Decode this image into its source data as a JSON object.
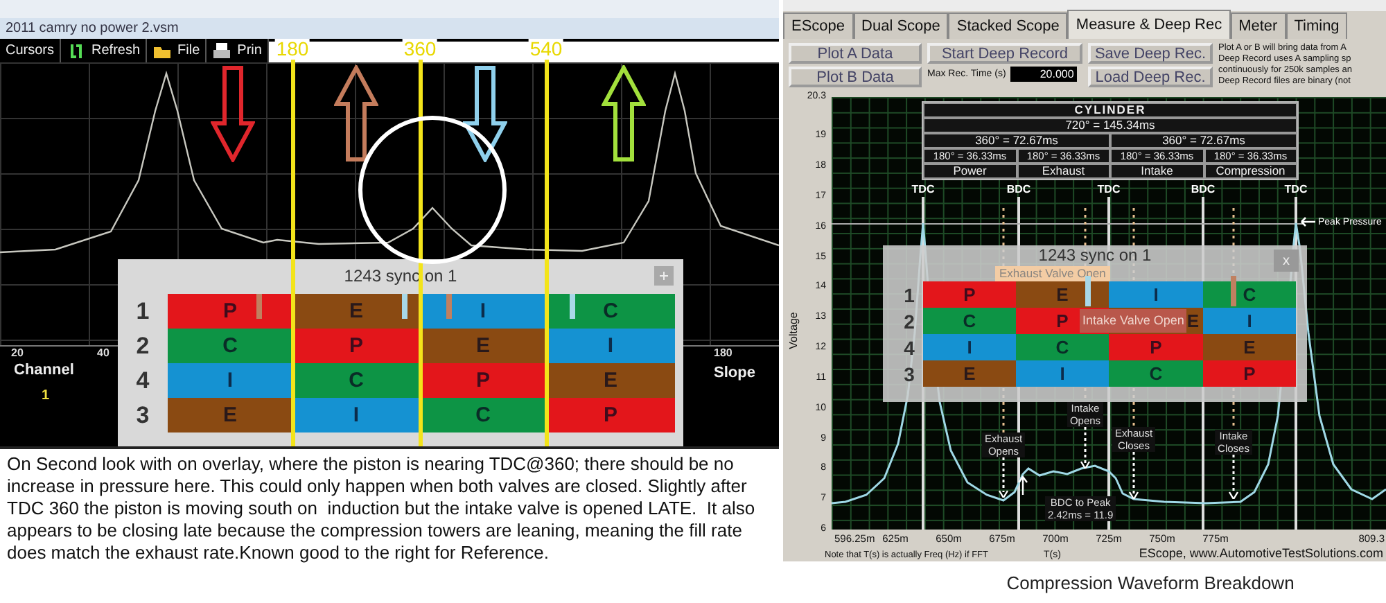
{
  "left_window": {
    "title": "2011 camry no power 2.vsm",
    "toolbar": [
      {
        "label": "Cursors"
      },
      {
        "label": "Refresh"
      },
      {
        "label": "File"
      },
      {
        "label": "Prin"
      }
    ],
    "cursor_labels": [
      "180",
      "360",
      "540"
    ],
    "arrows": [
      {
        "color": "#e0262c"
      },
      {
        "color": "#c47c5c"
      },
      {
        "color": "#8fd0ec"
      },
      {
        "color": "#a2e03c"
      }
    ],
    "scale_ticks": [
      "20",
      "40",
      "180"
    ],
    "channel_header": "Channel",
    "channel_value": "1",
    "slope_header": "Slope",
    "overlay": {
      "title": "1243 sync on 1",
      "rows": [
        {
          "cylinder": "1",
          "cells": [
            {
              "stroke": "P",
              "color": "#e3161b"
            },
            {
              "stroke": "E",
              "color": "#8a4a12"
            },
            {
              "stroke": "I",
              "color": "#1592d2"
            },
            {
              "stroke": "C",
              "color": "#0d9445"
            }
          ]
        },
        {
          "cylinder": "2",
          "cells": [
            {
              "stroke": "C",
              "color": "#0d9445"
            },
            {
              "stroke": "P",
              "color": "#e3161b"
            },
            {
              "stroke": "E",
              "color": "#8a4a12"
            },
            {
              "stroke": "I",
              "color": "#1592d2"
            }
          ]
        },
        {
          "cylinder": "4",
          "cells": [
            {
              "stroke": "I",
              "color": "#1592d2"
            },
            {
              "stroke": "C",
              "color": "#0d9445"
            },
            {
              "stroke": "P",
              "color": "#e3161b"
            },
            {
              "stroke": "E",
              "color": "#8a4a12"
            }
          ]
        },
        {
          "cylinder": "3",
          "cells": [
            {
              "stroke": "E",
              "color": "#8a4a12"
            },
            {
              "stroke": "I",
              "color": "#1592d2"
            },
            {
              "stroke": "C",
              "color": "#0d9445"
            },
            {
              "stroke": "P",
              "color": "#e3161b"
            }
          ]
        }
      ]
    }
  },
  "note": "On Second look with on overlay, where the piston is nearing TDC@360; there should be no increase in pressure here. This could only happen when both valves are closed. Slightly after TDC 360 the piston is moving south on  induction but the intake valve is opened LATE.  It also appears to be closing late because the compression towers are leaning, meaning the fill rate does match the exhaust rate.Known good to the right for Reference.",
  "right_window": {
    "tabs": [
      {
        "label": "EScope",
        "selected": false
      },
      {
        "label": "Dual Scope",
        "selected": false
      },
      {
        "label": "Stacked Scope",
        "selected": false
      },
      {
        "label": "Measure & Deep Rec",
        "selected": true
      },
      {
        "label": "Meter",
        "selected": false
      },
      {
        "label": "Timing",
        "selected": false
      }
    ],
    "plot_buttons": [
      "Plot A Data",
      "Plot B Data"
    ],
    "record_button": "Start Deep Record",
    "max_rec_label": "Max Rec. Time (s)",
    "max_rec_value": "20.000",
    "file_buttons": [
      "Save Deep Rec.",
      "Load Deep Rec."
    ],
    "info_lines": [
      "Plot A or B will bring data from A",
      "Deep Record uses A sampling sp",
      "continuously for 250k samples an",
      "Deep Record files are binary (not"
    ],
    "chart": {
      "y_title": "Voltage",
      "y_labels": [
        "20.3",
        "19",
        "18",
        "17",
        "16",
        "15",
        "14",
        "13",
        "12",
        "11",
        "10",
        "9",
        "8",
        "7",
        "6"
      ],
      "x_labels": [
        "596.25m",
        "625m",
        "650m",
        "675m",
        "700m",
        "725m",
        "750m",
        "775m",
        "809.3"
      ],
      "x_title": "T(s)",
      "fft_note": "Note that T(s) is actually Freq (Hz) if FFT",
      "credit": "EScope, www.AutomotiveTestSolutions.com",
      "cylinder_table": {
        "title": "CYLINDER",
        "cycle": "720° = 145.34ms",
        "halves": [
          "360° = 72.67ms",
          "360° = 72.67ms"
        ],
        "quarters": [
          "180° = 36.33ms",
          "180° = 36.33ms",
          "180° = 36.33ms",
          "180° = 36.33ms"
        ],
        "strokes": [
          "Power",
          "Exhaust",
          "Intake",
          "Compression"
        ]
      },
      "dead_centers": [
        "TDC",
        "BDC",
        "TDC",
        "BDC",
        "TDC"
      ],
      "peak_label": "Peak Pressure",
      "overlay": {
        "title": "1243 sync on 1",
        "close": "x",
        "exhaust_label": "Exhaust Valve Open",
        "intake_label": "Intake Valve Open",
        "rows": [
          {
            "cylinder": "1",
            "cells": [
              {
                "stroke": "P",
                "color": "#e3161b"
              },
              {
                "stroke": "E",
                "color": "#8a4a12"
              },
              {
                "stroke": "I",
                "color": "#1592d2"
              },
              {
                "stroke": "C",
                "color": "#0d9445"
              }
            ]
          },
          {
            "cylinder": "2",
            "cells": [
              {
                "stroke": "C",
                "color": "#0d9445"
              },
              {
                "stroke": "P",
                "color": "#e3161b"
              },
              {
                "stroke": "E",
                "color": "#8a4a12"
              },
              {
                "stroke": "I",
                "color": "#1592d2"
              }
            ]
          },
          {
            "cylinder": "4",
            "cells": [
              {
                "stroke": "I",
                "color": "#1592d2"
              },
              {
                "stroke": "C",
                "color": "#0d9445"
              },
              {
                "stroke": "P",
                "color": "#e3161b"
              },
              {
                "stroke": "E",
                "color": "#8a4a12"
              }
            ]
          },
          {
            "cylinder": "3",
            "cells": [
              {
                "stroke": "E",
                "color": "#8a4a12"
              },
              {
                "stroke": "I",
                "color": "#1592d2"
              },
              {
                "stroke": "C",
                "color": "#0d9445"
              },
              {
                "stroke": "P",
                "color": "#e3161b"
              }
            ]
          }
        ]
      },
      "events": [
        {
          "lines": [
            "Intake",
            "Opens"
          ]
        },
        {
          "lines": [
            "Exhaust",
            "Opens"
          ]
        },
        {
          "lines": [
            "Exhaust",
            "Closes"
          ]
        },
        {
          "lines": [
            "Intake",
            "Closes"
          ]
        }
      ],
      "bdc_to_peak": {
        "label": "BDC to Peak",
        "value": "2.42ms = 11.9"
      }
    },
    "caption": "Compression Waveform Breakdown"
  }
}
